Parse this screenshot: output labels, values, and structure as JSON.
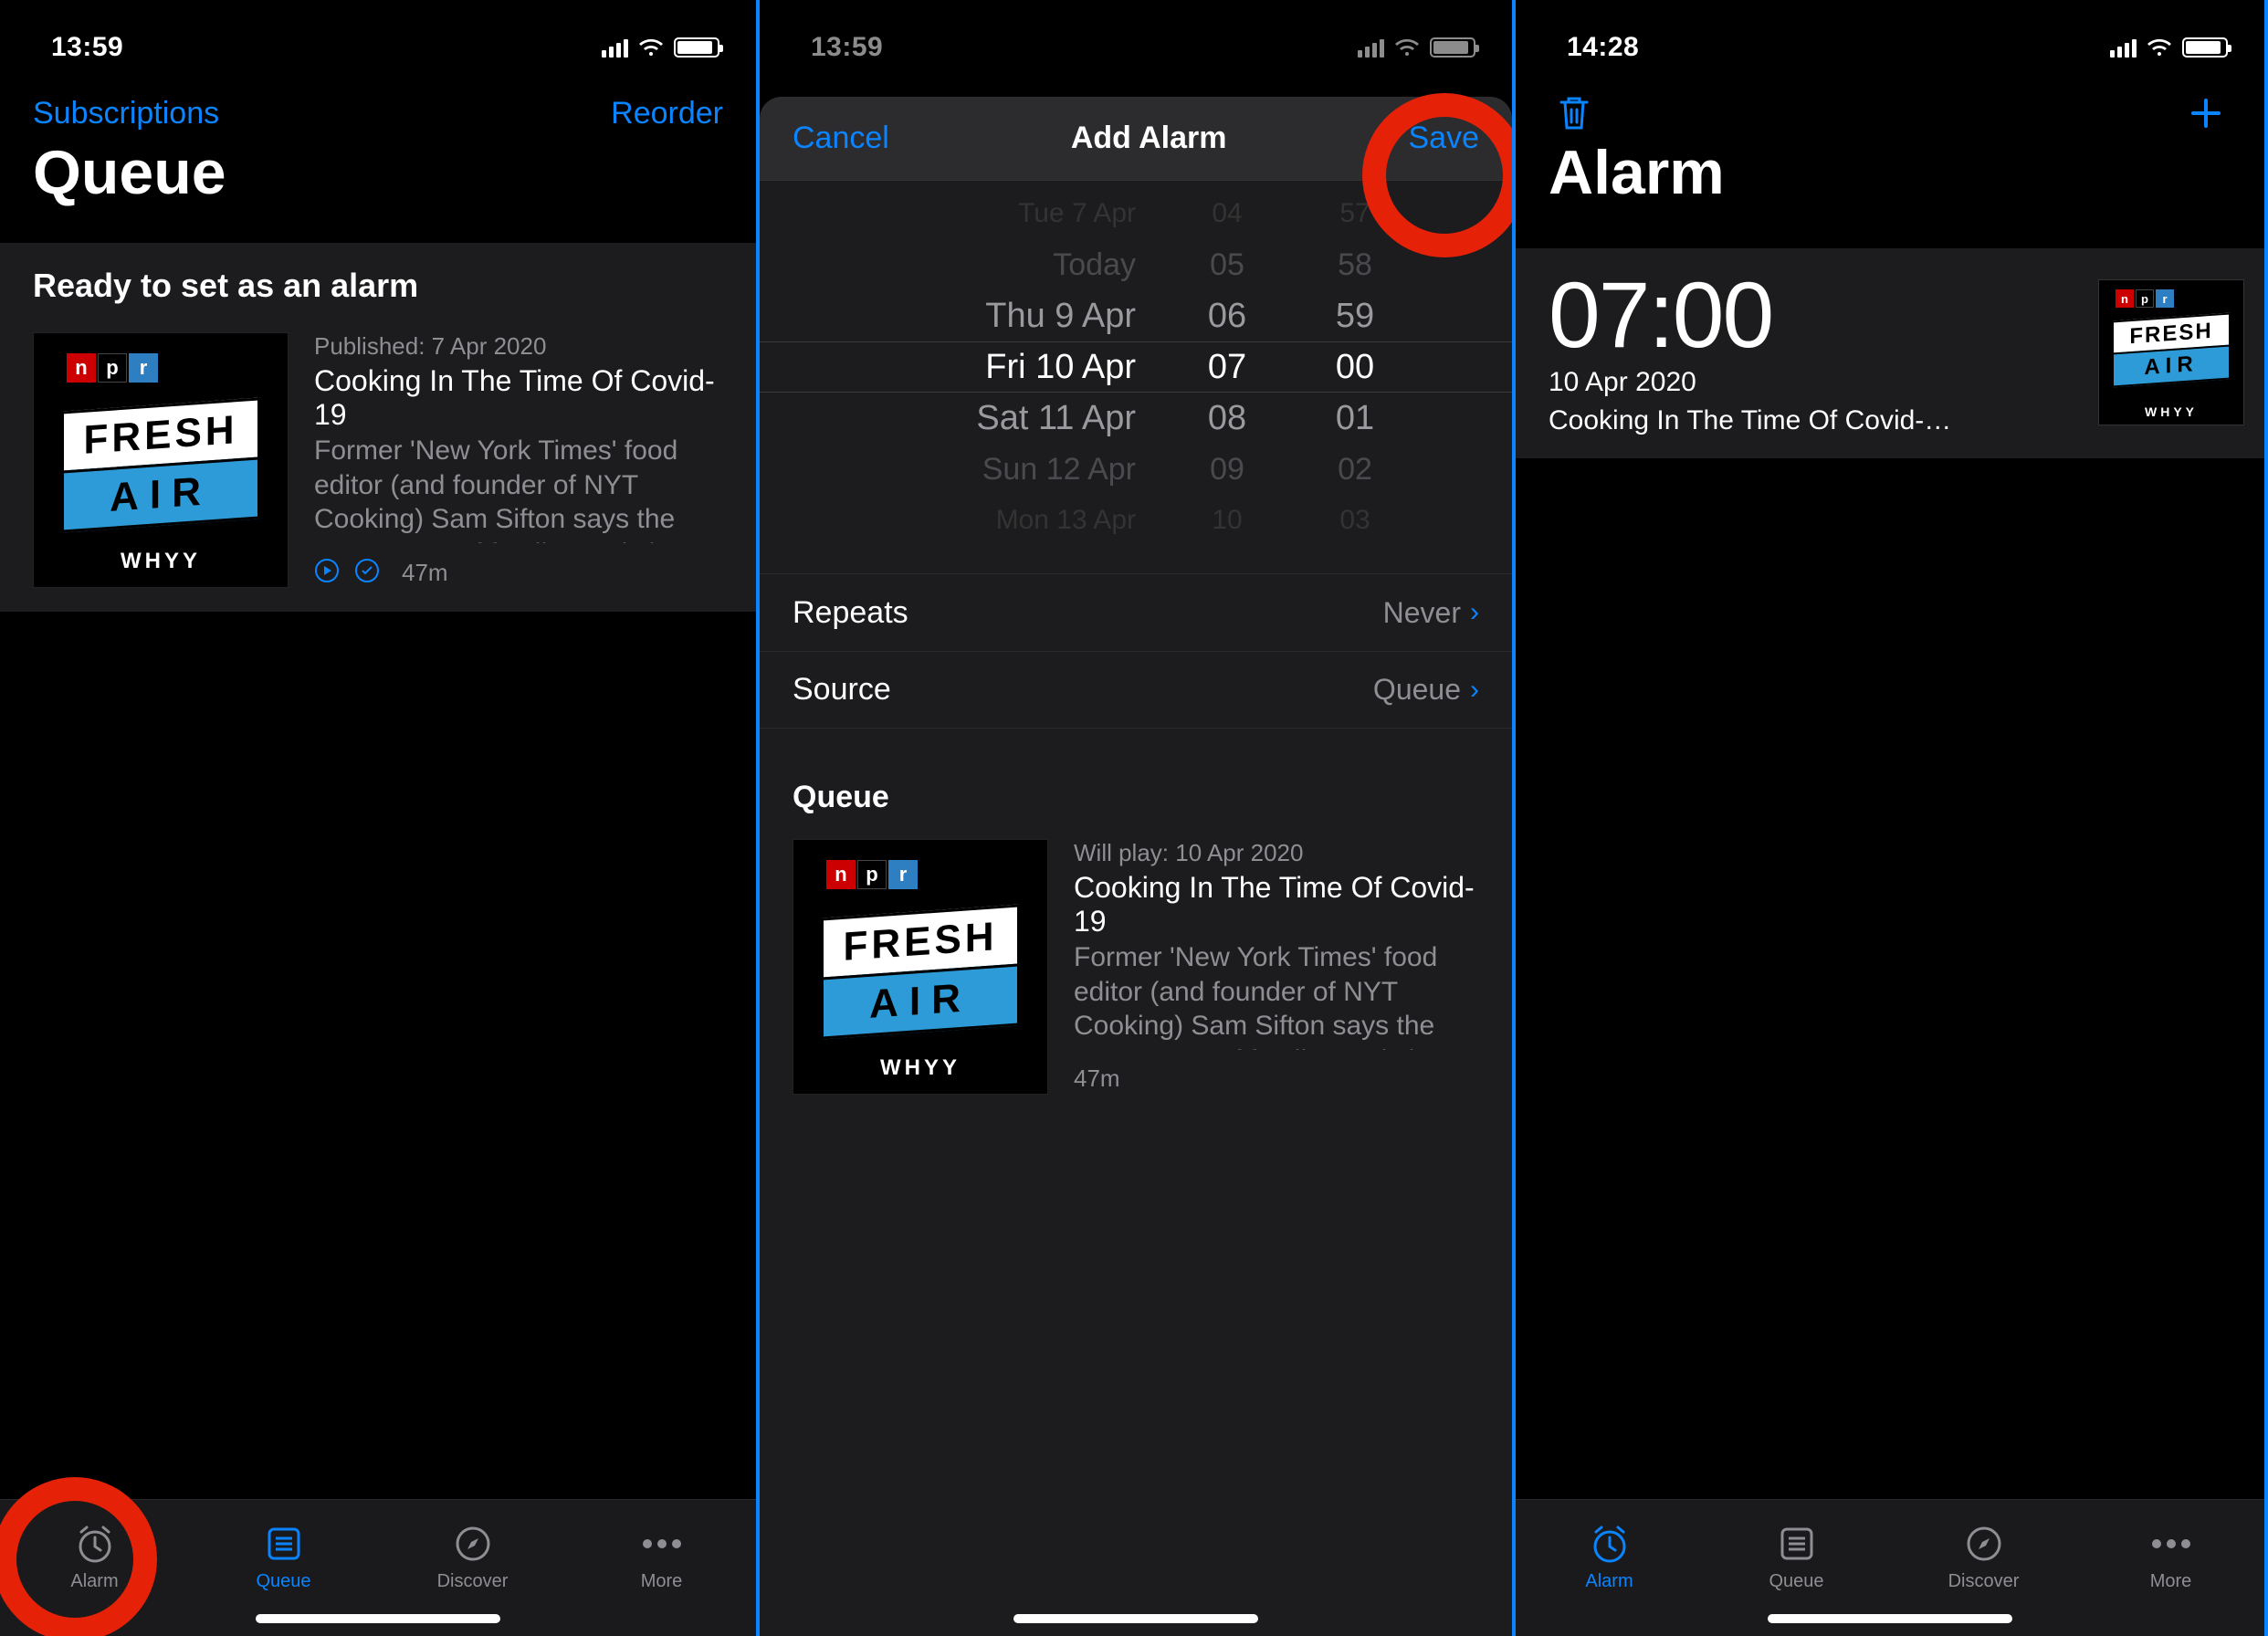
{
  "artwork": {
    "fresh": "FRESH",
    "air": "AIR",
    "whyy": "WHYY"
  },
  "tabs": {
    "alarm": "Alarm",
    "queue": "Queue",
    "discover": "Discover",
    "more": "More"
  },
  "screen1": {
    "status_time": "13:59",
    "nav_left": "Subscriptions",
    "nav_right": "Reorder",
    "title": "Queue",
    "section": "Ready to set as an alarm",
    "episode": {
      "published": "Published: 7 Apr 2020",
      "title": "Cooking In The Time Of Covid-19",
      "desc": "Former 'New York Times' food editor (and founder of NYT Cooking) Sam Sifton says the resurgence of family meals is o…",
      "duration": "47m"
    }
  },
  "screen2": {
    "status_time": "13:59",
    "modal": {
      "cancel": "Cancel",
      "title": "Add Alarm",
      "save": "Save"
    },
    "picker": {
      "dates": [
        "Tue 7 Apr",
        "Today",
        "Thu 9 Apr",
        "Fri 10 Apr",
        "Sat 11 Apr",
        "Sun 12 Apr",
        "Mon 13 Apr"
      ],
      "hours": [
        "04",
        "05",
        "06",
        "07",
        "08",
        "09",
        "10"
      ],
      "minutes": [
        "57",
        "58",
        "59",
        "00",
        "01",
        "02",
        "03"
      ]
    },
    "rows": {
      "repeats_label": "Repeats",
      "repeats_value": "Never",
      "source_label": "Source",
      "source_value": "Queue"
    },
    "queue_header": "Queue",
    "episode": {
      "will_play": "Will play: 10 Apr 2020",
      "title": "Cooking In The Time Of Covid-19",
      "desc": "Former 'New York Times' food editor (and founder of NYT Cooking) Sam Sifton says the resurgence of family meals is o…",
      "duration": "47m"
    }
  },
  "screen3": {
    "status_time": "14:28",
    "title": "Alarm",
    "alarm": {
      "time": "07:00",
      "date": "10 Apr 2020",
      "episode_title": "Cooking In The Time Of Covid-…"
    }
  }
}
